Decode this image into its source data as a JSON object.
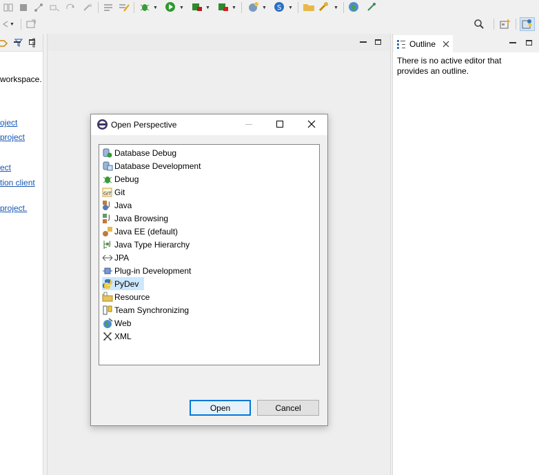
{
  "toolbar": {
    "row1_icons": [
      "split-editor-icon",
      "stop-icon",
      "git-icon",
      "run-last-icon",
      "redo-icon",
      "quick-access-icon",
      "debug-icon",
      "run-icon",
      "coverage-icon",
      "external-tools-icon",
      "new-server-icon",
      "spring-icon",
      "open-folder-icon",
      "search-icon",
      "globe-icon",
      "tool-icon"
    ],
    "row2_icons": [
      "nav-back-icon",
      "new-window-icon",
      "search-icon",
      "open-perspective-icon",
      "pydev-perspective-icon"
    ]
  },
  "left_panel": {
    "text_workspace": "workspace.",
    "links": [
      "oject",
      "project",
      "ect",
      "tion client",
      "project."
    ]
  },
  "outline": {
    "tab_label": "Outline",
    "message_line1": "There is no active editor that",
    "message_line2": "provides an outline."
  },
  "dialog": {
    "title": "Open Perspective",
    "items": [
      {
        "label": "Database Debug",
        "icon": "database-debug-icon"
      },
      {
        "label": "Database Development",
        "icon": "database-development-icon"
      },
      {
        "label": "Debug",
        "icon": "debug-bug-icon"
      },
      {
        "label": "Git",
        "icon": "git-icon"
      },
      {
        "label": "Java",
        "icon": "java-icon"
      },
      {
        "label": "Java Browsing",
        "icon": "java-browsing-icon"
      },
      {
        "label": "Java EE (default)",
        "icon": "java-ee-icon"
      },
      {
        "label": "Java Type Hierarchy",
        "icon": "java-type-hierarchy-icon"
      },
      {
        "label": "JPA",
        "icon": "jpa-icon"
      },
      {
        "label": "Plug-in Development",
        "icon": "plugin-development-icon"
      },
      {
        "label": "PyDev",
        "icon": "python-icon"
      },
      {
        "label": "Resource",
        "icon": "resource-folder-icon"
      },
      {
        "label": "Team Synchronizing",
        "icon": "team-sync-icon"
      },
      {
        "label": "Web",
        "icon": "web-globe-icon"
      },
      {
        "label": "XML",
        "icon": "xml-icon"
      }
    ],
    "selected_item": "PyDev",
    "open_label": "Open",
    "cancel_label": "Cancel"
  },
  "colors": {
    "selection": "#cce8ff",
    "link": "#1755b3",
    "default_button_border": "#0078d7"
  }
}
